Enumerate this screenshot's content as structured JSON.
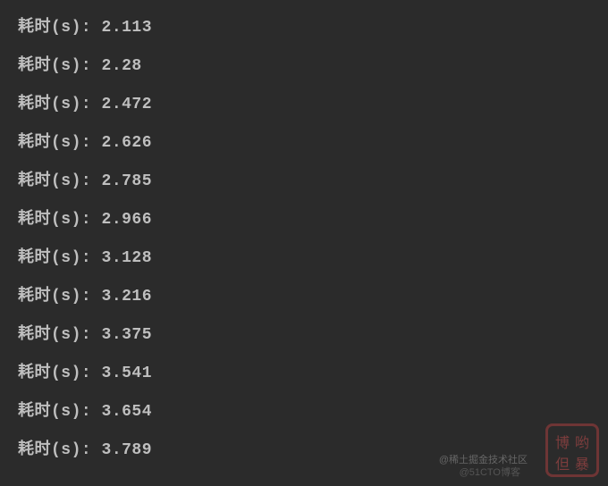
{
  "log": {
    "label": "耗时(s): ",
    "entries": [
      {
        "value": "2.113"
      },
      {
        "value": "2.28"
      },
      {
        "value": "2.472"
      },
      {
        "value": "2.626"
      },
      {
        "value": "2.785"
      },
      {
        "value": "2.966"
      },
      {
        "value": "3.128"
      },
      {
        "value": "3.216"
      },
      {
        "value": "3.375"
      },
      {
        "value": "3.541"
      },
      {
        "value": "3.654"
      },
      {
        "value": "3.789"
      }
    ]
  },
  "watermark": {
    "text1": "@稀土掘金技术社区",
    "text2": "@51CTO博客",
    "seal_chars": [
      "博",
      "哟",
      "但",
      "暴"
    ]
  }
}
